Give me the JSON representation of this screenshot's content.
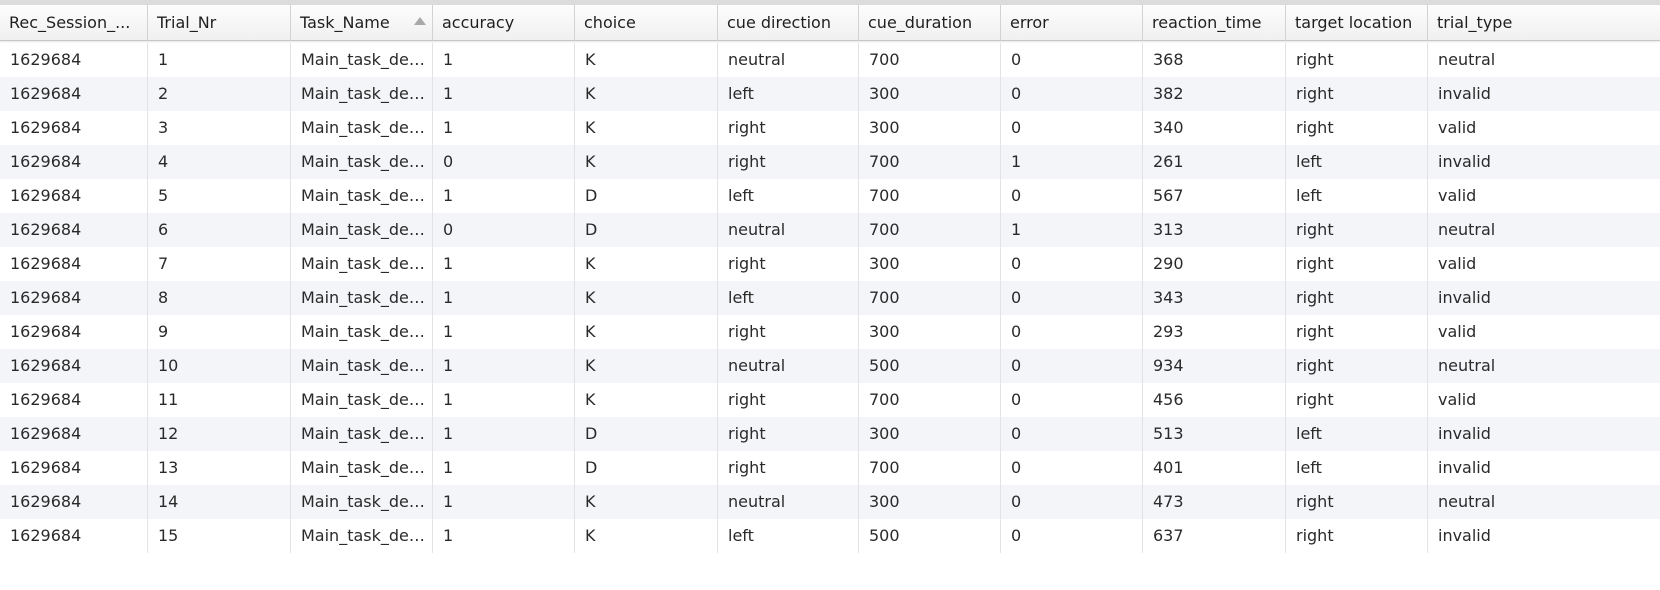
{
  "table": {
    "columns": [
      "Rec_Session_...",
      "Trial_Nr",
      "Task_Name",
      "accuracy",
      "choice",
      "cue direction",
      "cue_duration",
      "error",
      "reaction_time",
      "target location",
      "trial_type"
    ],
    "sorted_column": "Task_Name",
    "sort_direction": "ascending",
    "rows": [
      [
        "1629684",
        "1",
        "Main_task_des...",
        "1",
        "K",
        "neutral",
        "700",
        "0",
        "368",
        "right",
        "neutral"
      ],
      [
        "1629684",
        "2",
        "Main_task_des...",
        "1",
        "K",
        "left",
        "300",
        "0",
        "382",
        "right",
        "invalid"
      ],
      [
        "1629684",
        "3",
        "Main_task_des...",
        "1",
        "K",
        "right",
        "300",
        "0",
        "340",
        "right",
        "valid"
      ],
      [
        "1629684",
        "4",
        "Main_task_des...",
        "0",
        "K",
        "right",
        "700",
        "1",
        "261",
        "left",
        "invalid"
      ],
      [
        "1629684",
        "5",
        "Main_task_des...",
        "1",
        "D",
        "left",
        "700",
        "0",
        "567",
        "left",
        "valid"
      ],
      [
        "1629684",
        "6",
        "Main_task_des...",
        "0",
        "D",
        "neutral",
        "700",
        "1",
        "313",
        "right",
        "neutral"
      ],
      [
        "1629684",
        "7",
        "Main_task_des...",
        "1",
        "K",
        "right",
        "300",
        "0",
        "290",
        "right",
        "valid"
      ],
      [
        "1629684",
        "8",
        "Main_task_des...",
        "1",
        "K",
        "left",
        "700",
        "0",
        "343",
        "right",
        "invalid"
      ],
      [
        "1629684",
        "9",
        "Main_task_des...",
        "1",
        "K",
        "right",
        "300",
        "0",
        "293",
        "right",
        "valid"
      ],
      [
        "1629684",
        "10",
        "Main_task_des...",
        "1",
        "K",
        "neutral",
        "500",
        "0",
        "934",
        "right",
        "neutral"
      ],
      [
        "1629684",
        "11",
        "Main_task_des...",
        "1",
        "K",
        "right",
        "700",
        "0",
        "456",
        "right",
        "valid"
      ],
      [
        "1629684",
        "12",
        "Main_task_des...",
        "1",
        "D",
        "right",
        "300",
        "0",
        "513",
        "left",
        "invalid"
      ],
      [
        "1629684",
        "13",
        "Main_task_des...",
        "1",
        "D",
        "right",
        "700",
        "0",
        "401",
        "left",
        "invalid"
      ],
      [
        "1629684",
        "14",
        "Main_task_des...",
        "1",
        "K",
        "neutral",
        "300",
        "0",
        "473",
        "right",
        "neutral"
      ],
      [
        "1629684",
        "15",
        "Main_task_des...",
        "1",
        "K",
        "left",
        "500",
        "0",
        "637",
        "right",
        "invalid"
      ]
    ]
  },
  "colors": {
    "header_bg": "#f3f3f3",
    "row_alt_bg": "#f4f5f8",
    "row_bg": "#ffffff",
    "border": "#e3e3e3",
    "sort_icon": "#a9a9a9"
  }
}
